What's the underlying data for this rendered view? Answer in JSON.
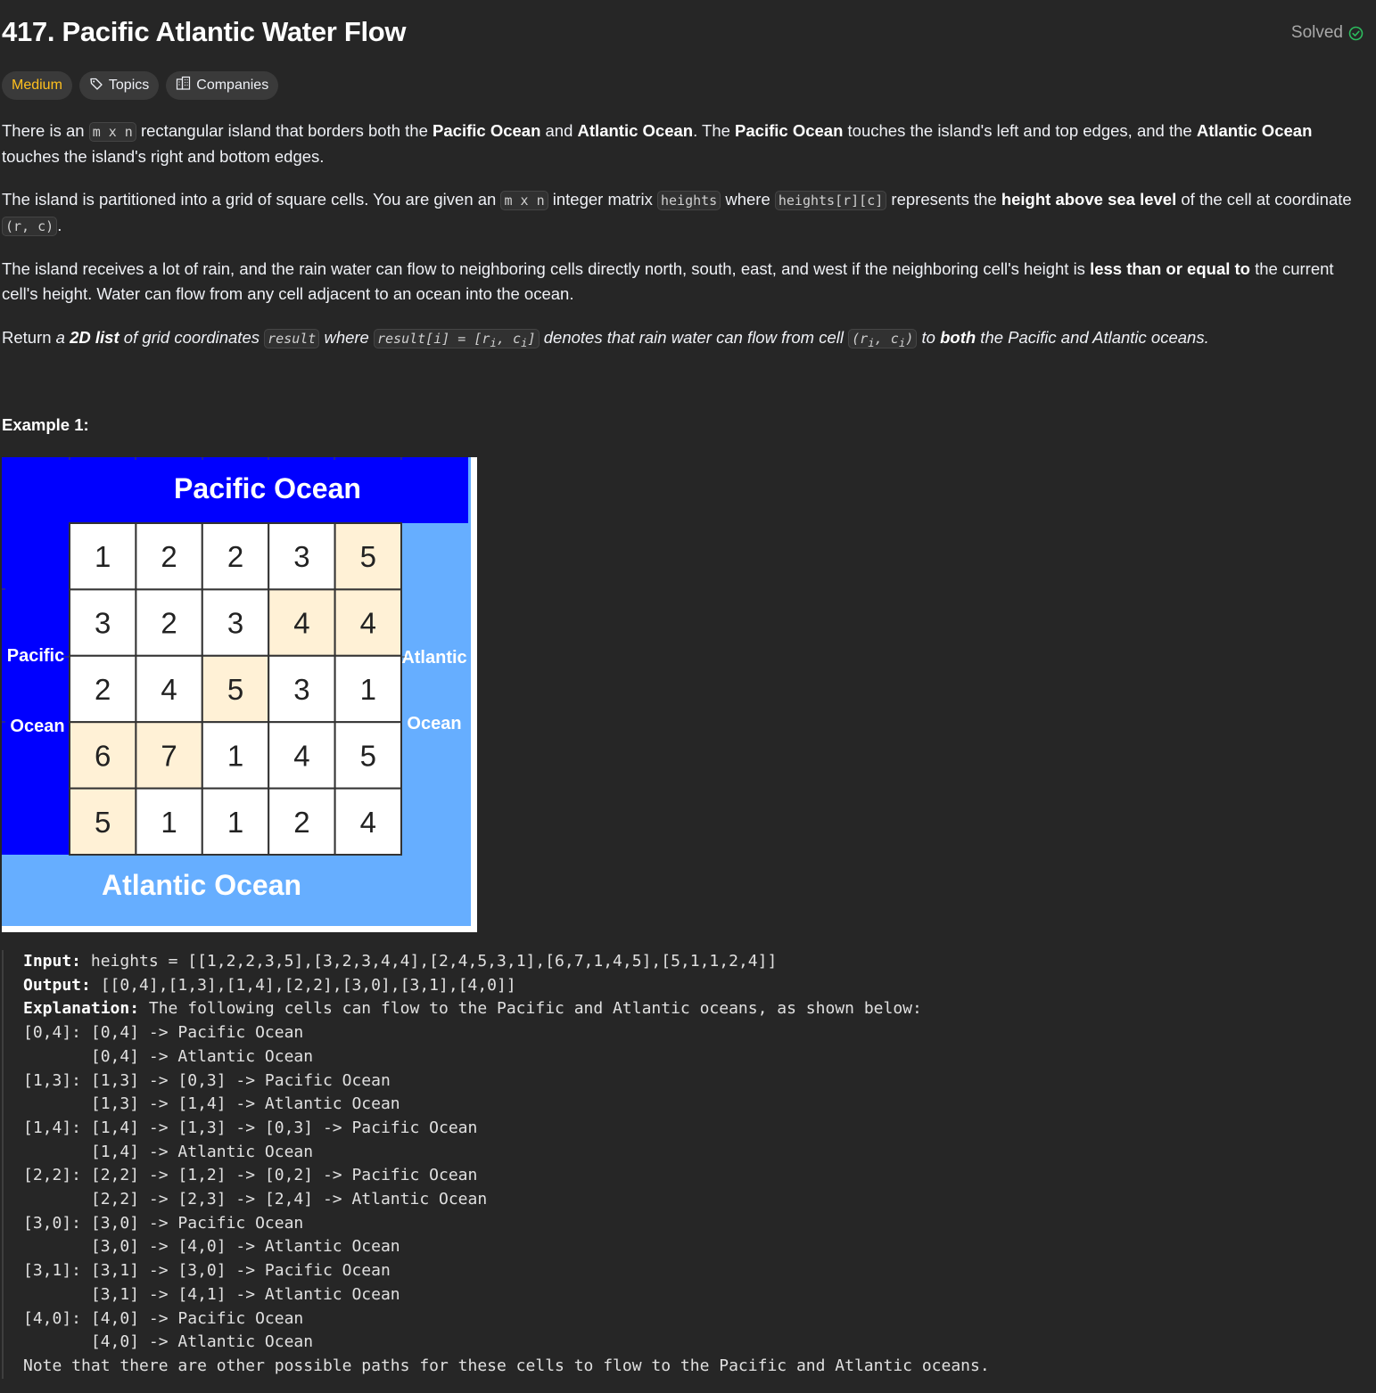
{
  "problem": {
    "title": "417. Pacific Atlantic Water Flow",
    "status": "Solved",
    "difficulty": "Medium",
    "topics_label": "Topics",
    "companies_label": "Companies"
  },
  "description": {
    "p1": {
      "a": "There is an ",
      "code1": "m x n",
      "b": " rectangular island that borders both the ",
      "bold1": "Pacific Ocean",
      "c": " and ",
      "bold2": "Atlantic Ocean",
      "d": ". The ",
      "bold3": "Pacific Ocean",
      "e": " touches the island's left and top edges, and the ",
      "bold4": "Atlantic Ocean",
      "f": " touches the island's right and bottom edges."
    },
    "p2": {
      "a": "The island is partitioned into a grid of square cells. You are given an ",
      "code1": "m x n",
      "b": " integer matrix ",
      "code2": "heights",
      "c": " where ",
      "code3": "heights[r][c]",
      "d": " represents the ",
      "bold1": "height above sea level",
      "e": " of the cell at coordinate ",
      "code4": "(r, c)",
      "f": "."
    },
    "p3": {
      "a": "The island receives a lot of rain, and the rain water can flow to neighboring cells directly north, south, east, and west if the neighboring cell's height is ",
      "bold1": "less than or equal to",
      "b": " the current cell's height. Water can flow from any cell adjacent to an ocean into the ocean."
    },
    "p4": {
      "a": "Return ",
      "it1": "a ",
      "bold1": "2D list",
      "it2": " of grid coordinates ",
      "code1": "result",
      "it3": " where ",
      "code2": "result[i] = [r",
      "sub1": "i",
      "code2b": ", c",
      "sub2": "i",
      "code2c": "]",
      "it4": " denotes that rain water can flow from cell ",
      "code3": "(r",
      "sub3": "i",
      "code3b": ", c",
      "sub4": "i",
      "code3c": ")",
      "it5": " to ",
      "bold2": "both",
      "it6": " the Pacific and Atlantic oceans."
    }
  },
  "example": {
    "title": "Example 1:",
    "figure": {
      "top_label": "Pacific Ocean",
      "bottom_label": "Atlantic Ocean",
      "left_label_1": "Pacific",
      "left_label_2": "Ocean",
      "right_label_1": "Atlantic",
      "right_label_2": "Ocean",
      "colors": {
        "pacific": "#0000ff",
        "atlantic": "#66aeff",
        "highlight": "#fff1d6",
        "cell": "#ffffff"
      },
      "grid": [
        [
          1,
          2,
          2,
          3,
          5
        ],
        [
          3,
          2,
          3,
          4,
          4
        ],
        [
          2,
          4,
          5,
          3,
          1
        ],
        [
          6,
          7,
          1,
          4,
          5
        ],
        [
          5,
          1,
          1,
          2,
          4
        ]
      ],
      "highlighted": [
        [
          0,
          4
        ],
        [
          1,
          3
        ],
        [
          1,
          4
        ],
        [
          2,
          2
        ],
        [
          3,
          0
        ],
        [
          3,
          1
        ],
        [
          4,
          0
        ]
      ]
    },
    "input_label": "Input:",
    "input_value": " heights = [[1,2,2,3,5],[3,2,3,4,4],[2,4,5,3,1],[6,7,1,4,5],[5,1,1,2,4]]",
    "output_label": "Output:",
    "output_value": " [[0,4],[1,3],[1,4],[2,2],[3,0],[3,1],[4,0]]",
    "explanation_label": "Explanation:",
    "explanation_value": " The following cells can flow to the Pacific and Atlantic oceans, as shown below:",
    "lines": [
      "[0,4]: [0,4] -> Pacific Ocean",
      "       [0,4] -> Atlantic Ocean",
      "[1,3]: [1,3] -> [0,3] -> Pacific Ocean",
      "       [1,3] -> [1,4] -> Atlantic Ocean",
      "[1,4]: [1,4] -> [1,3] -> [0,3] -> Pacific Ocean",
      "       [1,4] -> Atlantic Ocean",
      "[2,2]: [2,2] -> [1,2] -> [0,2] -> Pacific Ocean",
      "       [2,2] -> [2,3] -> [2,4] -> Atlantic Ocean",
      "[3,0]: [3,0] -> Pacific Ocean",
      "       [3,0] -> [4,0] -> Atlantic Ocean",
      "[3,1]: [3,1] -> [3,0] -> Pacific Ocean",
      "       [3,1] -> [4,1] -> Atlantic Ocean",
      "[4,0]: [4,0] -> Pacific Ocean",
      "       [4,0] -> Atlantic Ocean"
    ],
    "note": "Note that there are other possible paths for these cells to flow to the Pacific and Atlantic oceans."
  }
}
